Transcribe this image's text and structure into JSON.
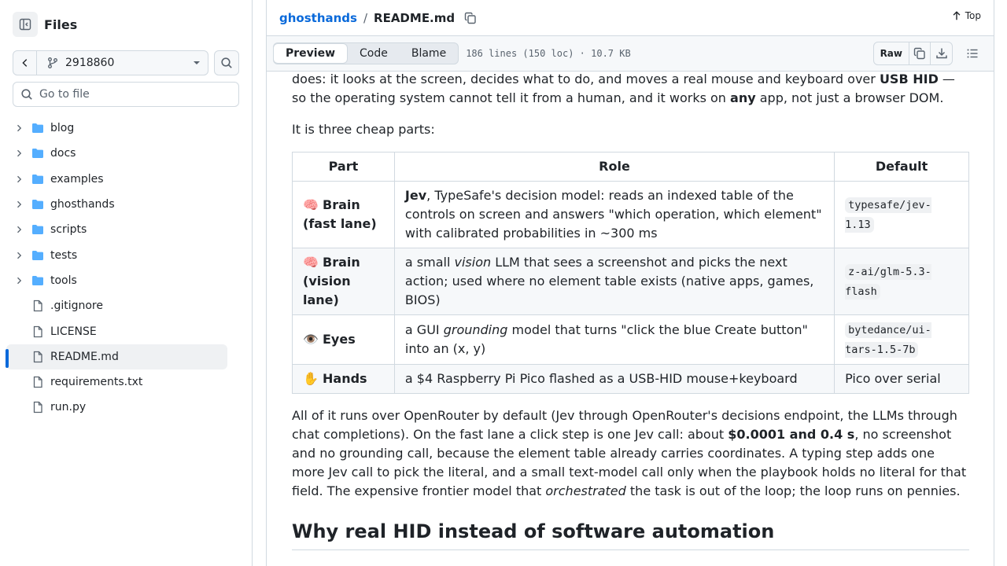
{
  "sidebar": {
    "title": "Files",
    "branch": "2918860",
    "goto_placeholder": "Go to file",
    "items": [
      {
        "label": "blog",
        "type": "folder"
      },
      {
        "label": "docs",
        "type": "folder"
      },
      {
        "label": "examples",
        "type": "folder"
      },
      {
        "label": "ghosthands",
        "type": "folder"
      },
      {
        "label": "scripts",
        "type": "folder"
      },
      {
        "label": "tests",
        "type": "folder"
      },
      {
        "label": "tools",
        "type": "folder"
      },
      {
        "label": ".gitignore",
        "type": "file"
      },
      {
        "label": "LICENSE",
        "type": "file"
      },
      {
        "label": "README.md",
        "type": "file",
        "selected": true
      },
      {
        "label": "requirements.txt",
        "type": "file"
      },
      {
        "label": "run.py",
        "type": "file"
      }
    ]
  },
  "header": {
    "repo": "ghosthands",
    "separator": "/",
    "file": "README.md",
    "top_label": "Top"
  },
  "toolbar": {
    "tabs": [
      "Preview",
      "Code",
      "Blame"
    ],
    "active_tab": "Preview",
    "meta": "186 lines (150 loc) · 10.7 KB",
    "raw_label": "Raw"
  },
  "content": {
    "intro": {
      "t1": "does: it looks at the screen, decides what to do, and moves a real mouse and keyboard over ",
      "b1": "USB HID",
      "t2": " — so the operating system cannot tell it from a human, and it works on ",
      "b2": "any",
      "t3": " app, not just a browser DOM."
    },
    "parts_intro": "It is three cheap parts:",
    "table": {
      "headers": [
        "Part",
        "Role",
        "Default"
      ],
      "rows": [
        {
          "emoji": "🧠",
          "part": "Brain (fast lane)",
          "role_b": "Jev",
          "role": ", TypeSafe's decision model: reads an indexed table of the controls on screen and answers \"which operation, which element\" with calibrated probabilities in ~300 ms",
          "default": "typesafe/jev-1.13"
        },
        {
          "emoji": "🧠",
          "part": "Brain (vision lane)",
          "role_pre": "a small ",
          "role_i": "vision",
          "role": " LLM that sees a screenshot and picks the next action; used where no element table exists (native apps, games, BIOS)",
          "default": "z-ai/glm-5.3-flash"
        },
        {
          "emoji": "👁️",
          "part": "Eyes",
          "role_pre": "a GUI ",
          "role_i": "grounding",
          "role": " model that turns \"click the blue Create button\" into an (x, y)",
          "default": "bytedance/ui-tars-1.5-7b"
        },
        {
          "emoji": "✋",
          "part": "Hands",
          "role": "a $4 Raspberry Pi Pico flashed as a USB-HID mouse+keyboard",
          "default": "Pico over serial"
        }
      ]
    },
    "para2": {
      "t1": "All of it runs over OpenRouter by default (Jev through OpenRouter's decisions endpoint, the LLMs through chat completions). On the fast lane a click step is one Jev call: about ",
      "b1": "$0.0001 and 0.4 s",
      "t2": ", no screenshot and no grounding call, because the element table already carries coordinates. A typing step adds one more Jev call to pick the literal, and a small text-model call only when the playbook holds no literal for that field. The expensive frontier model that ",
      "i1": "orchestrated",
      "t3": " the task is out of the loop; the loop runs on pennies."
    },
    "heading": "Why real HID instead of software automation"
  },
  "colors": {
    "accent": "#0969da",
    "folder": "#54aeff",
    "border": "#d1d9e0",
    "muted": "#59636e"
  }
}
